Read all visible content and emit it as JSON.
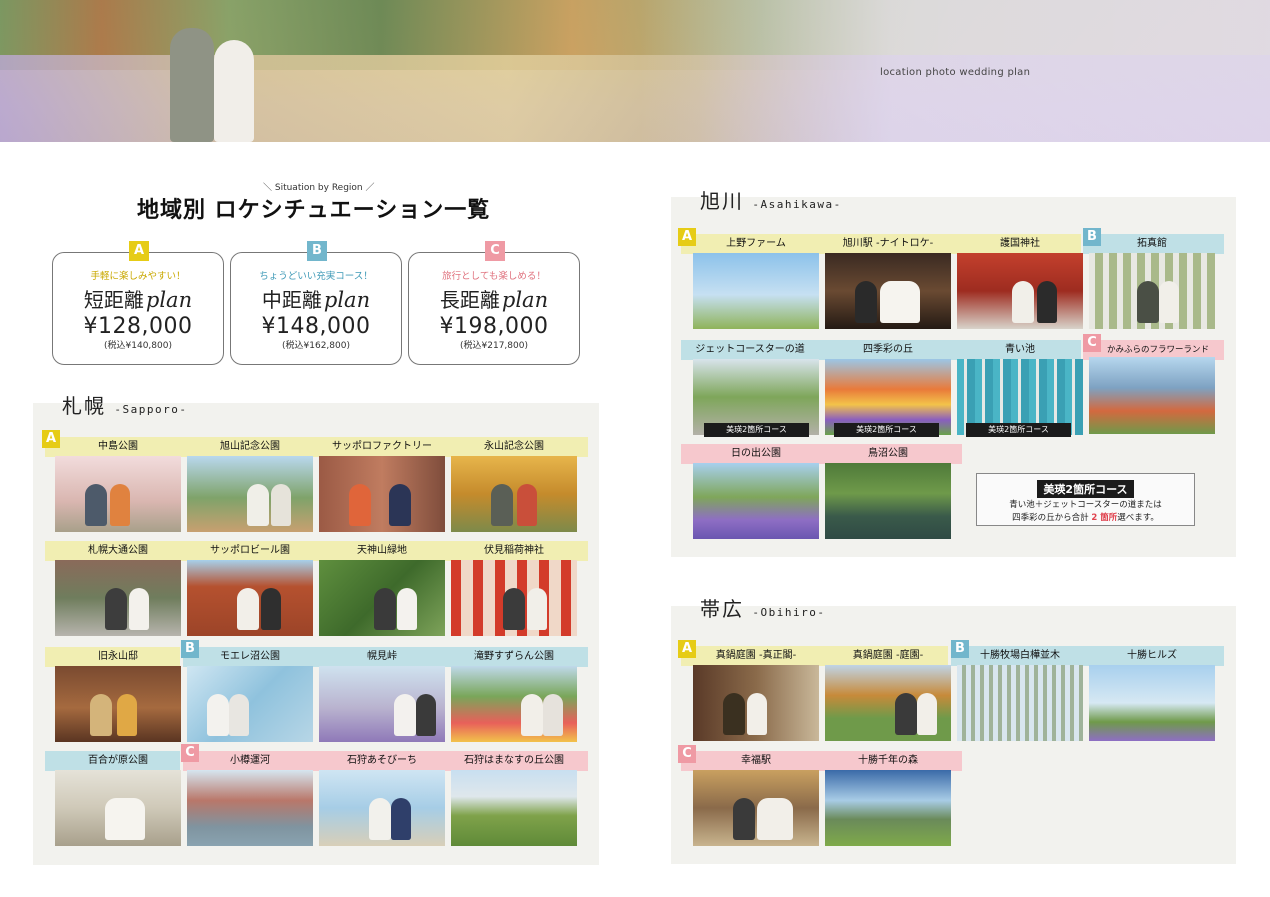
{
  "hero": {
    "tagline": "location  photo wedding plan"
  },
  "heading": {
    "sub": "＼ Situation by Region ／",
    "title": "地域別 ロケシチュエーション一覧"
  },
  "plans": [
    {
      "letter": "A",
      "tag": "手軽に楽しみやすい！",
      "name": "短距離",
      "script": "plan",
      "price": "¥128,000",
      "tax": "(税込¥140,800)",
      "color": "#e6cc16"
    },
    {
      "letter": "B",
      "tag": "ちょうどいい充実コース！",
      "name": "中距離",
      "script": "plan",
      "price": "¥148,000",
      "tax": "(税込¥162,800)",
      "color": "#72b6cc"
    },
    {
      "letter": "C",
      "tag": "旅行としても楽しめる！",
      "name": "長距離",
      "script": "plan",
      "price": "¥198,000",
      "tax": "(税込¥217,800)",
      "color": "#ef9aa4"
    }
  ],
  "sapporo": {
    "title": "札幌",
    "en": "-Sapporo-",
    "rows": [
      [
        "中島公園",
        "旭山記念公園",
        "サッポロファクトリー",
        "永山記念公園"
      ],
      [
        "札幌大通公園",
        "サッポロビール園",
        "天神山緑地",
        "伏見稲荷神社"
      ],
      [
        "旧永山邸",
        "モエレ沼公園",
        "幌見峠",
        "滝野すずらん公園"
      ],
      [
        "百合が原公園",
        "小樽運河",
        "石狩あそびーち",
        "石狩はまなすの丘公園"
      ]
    ]
  },
  "asahikawa": {
    "title": "旭川",
    "en": "-Asahikawa-",
    "row1": [
      "上野ファーム",
      "旭川駅 -ナイトロケ-",
      "護国神社",
      "拓真館"
    ],
    "row2": [
      "ジェットコースターの道",
      "四季彩の丘",
      "青い池",
      "かみふらのフラワーランド"
    ],
    "row3": [
      "日の出公園",
      "鳥沼公園"
    ],
    "overlay": "美瑛2箇所コース",
    "note": {
      "title": "美瑛2箇所コース",
      "line1": "青い池＋ジェットコースターの道または",
      "line2_pre": "四季彩の丘から合計 ",
      "line2_em": "2 箇所",
      "line2_post": "選べます。"
    }
  },
  "obihiro": {
    "title": "帯広",
    "en": "-Obihiro-",
    "row1": [
      "真鍋庭園 -真正閣-",
      "真鍋庭園 -庭園-",
      "十勝牧場白樺並木",
      "十勝ヒルズ"
    ],
    "row2": [
      "幸福駅",
      "十勝千年の森"
    ]
  },
  "letters": {
    "a": "A",
    "b": "B",
    "c": "C"
  }
}
